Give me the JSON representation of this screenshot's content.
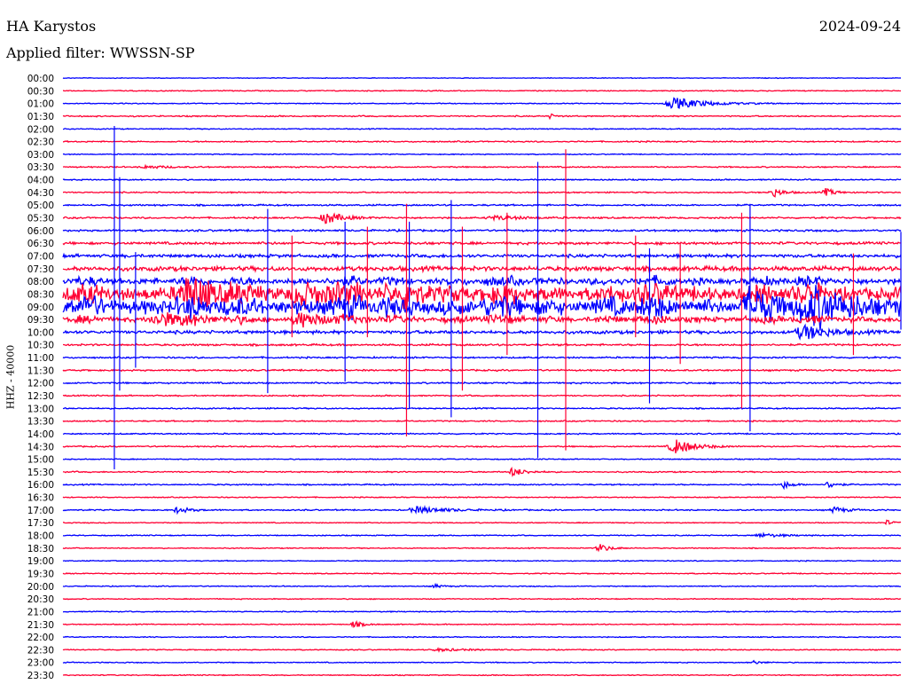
{
  "header": {
    "station": "HA Karystos",
    "date": "2024-09-24",
    "filter": "Applied filter: WWSSN-SP"
  },
  "chart_data": {
    "type": "line",
    "title": "HA Karystos",
    "subtitle": "Applied filter: WWSSN-SP",
    "ylabel": "HHZ - 40000",
    "xlabel": "",
    "minutes_per_row": 30,
    "row_labels": [
      "00:00",
      "00:30",
      "01:00",
      "01:30",
      "02:00",
      "02:30",
      "03:00",
      "03:30",
      "04:00",
      "04:30",
      "05:00",
      "05:30",
      "06:00",
      "06:30",
      "07:00",
      "07:30",
      "08:00",
      "08:30",
      "09:00",
      "09:30",
      "10:00",
      "10:30",
      "11:00",
      "11:30",
      "12:00",
      "12:30",
      "13:00",
      "13:30",
      "14:00",
      "14:30",
      "15:00",
      "15:30",
      "16:00",
      "16:30",
      "17:00",
      "17:30",
      "18:00",
      "18:30",
      "19:00",
      "19:30",
      "20:00",
      "20:30",
      "21:00",
      "21:30",
      "22:00",
      "22:30",
      "23:00",
      "23:30"
    ],
    "series_colors": [
      "#0000ff",
      "#ff0033"
    ],
    "row_noise": [
      0.02,
      0.03,
      0.03,
      0.04,
      0.03,
      0.04,
      0.03,
      0.04,
      0.04,
      0.04,
      0.05,
      0.05,
      0.06,
      0.08,
      0.1,
      0.14,
      0.25,
      0.55,
      0.6,
      0.22,
      0.1,
      0.06,
      0.05,
      0.05,
      0.05,
      0.04,
      0.04,
      0.04,
      0.04,
      0.04,
      0.03,
      0.04,
      0.04,
      0.03,
      0.04,
      0.03,
      0.03,
      0.03,
      0.03,
      0.03,
      0.03,
      0.03,
      0.03,
      0.03,
      0.03,
      0.03,
      0.03,
      0.03
    ],
    "events": [
      {
        "row": 2,
        "minute": 21.9,
        "amp": 0.45,
        "dur": 1.6
      },
      {
        "row": 3,
        "minute": 17.4,
        "amp": 0.2,
        "dur": 0.3
      },
      {
        "row": 7,
        "minute": 3.0,
        "amp": 0.12,
        "dur": 1.0
      },
      {
        "row": 9,
        "minute": 25.4,
        "amp": 0.4,
        "dur": 0.5
      },
      {
        "row": 9,
        "minute": 27.3,
        "amp": 0.3,
        "dur": 0.5
      },
      {
        "row": 11,
        "minute": 9.4,
        "amp": 0.5,
        "dur": 0.8
      },
      {
        "row": 11,
        "minute": 15.5,
        "amp": 0.15,
        "dur": 1.5
      },
      {
        "row": 17,
        "minute": 4.5,
        "amp": 0.7,
        "dur": 2.0
      },
      {
        "row": 17,
        "minute": 8.5,
        "amp": 0.6,
        "dur": 1.5
      },
      {
        "row": 17,
        "minute": 12.3,
        "amp": 0.9,
        "dur": 0.8
      },
      {
        "row": 18,
        "minute": 24.6,
        "amp": 1.0,
        "dur": 1.2
      },
      {
        "row": 18,
        "minute": 27.0,
        "amp": 0.9,
        "dur": 2.5
      },
      {
        "row": 19,
        "minute": 3.5,
        "amp": 0.5,
        "dur": 1.5
      },
      {
        "row": 19,
        "minute": 8.5,
        "amp": 0.5,
        "dur": 1.2
      },
      {
        "row": 20,
        "minute": 26.5,
        "amp": 0.6,
        "dur": 1.2
      },
      {
        "row": 29,
        "minute": 21.9,
        "amp": 0.6,
        "dur": 1.0
      },
      {
        "row": 31,
        "minute": 16.1,
        "amp": 0.35,
        "dur": 0.6
      },
      {
        "row": 32,
        "minute": 25.8,
        "amp": 0.3,
        "dur": 0.4
      },
      {
        "row": 32,
        "minute": 27.4,
        "amp": 0.3,
        "dur": 0.4
      },
      {
        "row": 34,
        "minute": 4.1,
        "amp": 0.25,
        "dur": 0.6
      },
      {
        "row": 34,
        "minute": 12.7,
        "amp": 0.25,
        "dur": 1.5
      },
      {
        "row": 34,
        "minute": 27.6,
        "amp": 0.25,
        "dur": 0.6
      },
      {
        "row": 35,
        "minute": 29.5,
        "amp": 0.2,
        "dur": 0.3
      },
      {
        "row": 36,
        "minute": 25.0,
        "amp": 0.15,
        "dur": 1.2
      },
      {
        "row": 37,
        "minute": 19.2,
        "amp": 0.35,
        "dur": 0.5
      },
      {
        "row": 40,
        "minute": 13.3,
        "amp": 0.15,
        "dur": 0.4
      },
      {
        "row": 43,
        "minute": 10.4,
        "amp": 0.25,
        "dur": 0.5
      },
      {
        "row": 45,
        "minute": 13.5,
        "amp": 0.1,
        "dur": 1.5
      },
      {
        "row": 46,
        "minute": 24.7,
        "amp": 0.15,
        "dur": 0.4
      }
    ],
    "spikes": [
      {
        "minute": 1.84,
        "from": 3.77,
        "to": 30.8,
        "color": 0
      },
      {
        "minute": 2.03,
        "from": 7.8,
        "to": 24.6,
        "color": 0
      },
      {
        "minute": 2.6,
        "from": 13.7,
        "to": 22.8,
        "color": 0
      },
      {
        "minute": 7.33,
        "from": 10.3,
        "to": 24.8,
        "color": 0
      },
      {
        "minute": 8.2,
        "from": 12.4,
        "to": 20.4,
        "color": 1
      },
      {
        "minute": 10.1,
        "from": 11.3,
        "to": 23.9,
        "color": 0
      },
      {
        "minute": 10.9,
        "from": 11.7,
        "to": 20.4,
        "color": 1
      },
      {
        "minute": 12.3,
        "from": 9.9,
        "to": 28.2,
        "color": 1
      },
      {
        "minute": 12.4,
        "from": 11.3,
        "to": 26.0,
        "color": 0
      },
      {
        "minute": 13.9,
        "from": 9.6,
        "to": 26.7,
        "color": 0
      },
      {
        "minute": 14.3,
        "from": 11.7,
        "to": 24.6,
        "color": 1
      },
      {
        "minute": 15.9,
        "from": 10.6,
        "to": 21.8,
        "color": 1
      },
      {
        "minute": 17.0,
        "from": 6.6,
        "to": 29.9,
        "color": 0
      },
      {
        "minute": 18.0,
        "from": 5.6,
        "to": 29.3,
        "color": 1
      },
      {
        "minute": 20.5,
        "from": 12.4,
        "to": 20.4,
        "color": 1
      },
      {
        "minute": 21.0,
        "from": 13.4,
        "to": 25.6,
        "color": 0
      },
      {
        "minute": 22.1,
        "from": 13.0,
        "to": 22.5,
        "color": 1
      },
      {
        "minute": 24.3,
        "from": 10.6,
        "to": 26.0,
        "color": 1
      },
      {
        "minute": 24.6,
        "from": 9.9,
        "to": 27.8,
        "color": 0
      },
      {
        "minute": 28.3,
        "from": 13.8,
        "to": 21.8,
        "color": 1
      },
      {
        "minute": 30.0,
        "from": 12.1,
        "to": 19.8,
        "color": 0
      }
    ]
  }
}
